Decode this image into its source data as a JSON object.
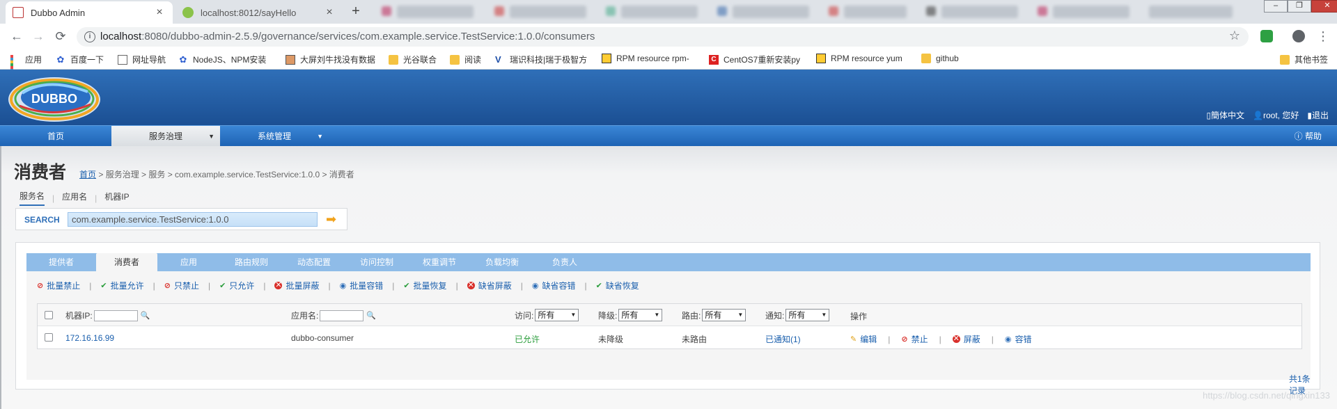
{
  "browser": {
    "tabs": [
      {
        "title": "Dubbo Admin",
        "close": "×"
      },
      {
        "title": "localhost:8012/sayHello",
        "close": "×"
      }
    ],
    "new_tab": "+",
    "url": {
      "host": "localhost",
      "rest": ":8080/dubbo-admin-2.5.9/governance/services/com.example.service.TestService:1.0.0/consumers"
    },
    "bookmarks": [
      "应用",
      "百度一下",
      "网址导航",
      "NodeJS、NPM安装",
      "大屏刘牛找没有数据",
      "光谷联合",
      "阅读",
      "瑞识科技|瑞于极智方",
      "RPM resource rpm-",
      "CentOS7重新安装py",
      "RPM resource yum",
      "github"
    ],
    "other_bookmarks": "其他书签",
    "nav_icons": {
      "back": "←",
      "forward": "→",
      "reload": "⟳",
      "info": "i",
      "star": "☆",
      "menu": "⋮"
    }
  },
  "header": {
    "logo_text": "DUBBO",
    "links": {
      "language": "簡体中文",
      "user": "root, 您好",
      "logout": "退出"
    }
  },
  "nav": {
    "items": [
      "首页",
      "服务治理",
      "系统管理"
    ],
    "help": "帮助"
  },
  "page": {
    "title": "消费者",
    "breadcrumb": {
      "home": "首页",
      "rest": " > 服务治理 > 服务 > com.example.service.TestService:1.0.0 > 消费者"
    },
    "search_tabs": [
      "服务名",
      "应用名",
      "机器IP"
    ],
    "search_label": "SEARCH",
    "search_value": "com.example.service.TestService:1.0.0"
  },
  "panel": {
    "tabs": [
      "提供者",
      "消费者",
      "应用",
      "路由规则",
      "动态配置",
      "访问控制",
      "权重调节",
      "负载均衡",
      "负责人"
    ],
    "actions": [
      {
        "icon": "ban-icon",
        "label": "批量禁止"
      },
      {
        "icon": "check-icon",
        "label": "批量允许"
      },
      {
        "icon": "ban-icon",
        "label": "只禁止"
      },
      {
        "icon": "check-icon",
        "label": "只允许"
      },
      {
        "icon": "x-circle-icon",
        "label": "批量屏蔽"
      },
      {
        "icon": "tolerance-icon",
        "label": "批量容错"
      },
      {
        "icon": "check-icon",
        "label": "批量恢复"
      },
      {
        "icon": "x-circle-icon",
        "label": "缺省屏蔽"
      },
      {
        "icon": "tolerance-icon",
        "label": "缺省容错"
      },
      {
        "icon": "check-icon",
        "label": "缺省恢复"
      }
    ],
    "table": {
      "headers": {
        "ip": "机器IP:",
        "app": "应用名:",
        "access": "访问:",
        "degrade": "降级:",
        "route": "路由:",
        "notify": "通知:",
        "ops": "操作"
      },
      "filter_value": "所有",
      "rows": [
        {
          "ip": "172.16.16.99",
          "app": "dubbo-consumer",
          "access": "已允许",
          "degrade": "未降级",
          "route": "未路由",
          "notify": "已通知(1)",
          "ops": [
            "编辑",
            "禁止",
            "屏蔽",
            "容错"
          ]
        }
      ]
    },
    "record_count": "共1条记录"
  },
  "watermark": "https://blog.csdn.net/qingxin133",
  "colors": {
    "header_blue": "#1b4f93",
    "nav_blue": "#2a73c8",
    "tab_blue": "#8fbce8",
    "link": "#1a5fad",
    "ok_green": "#2a9d3b",
    "ban_red": "#d9302b"
  }
}
